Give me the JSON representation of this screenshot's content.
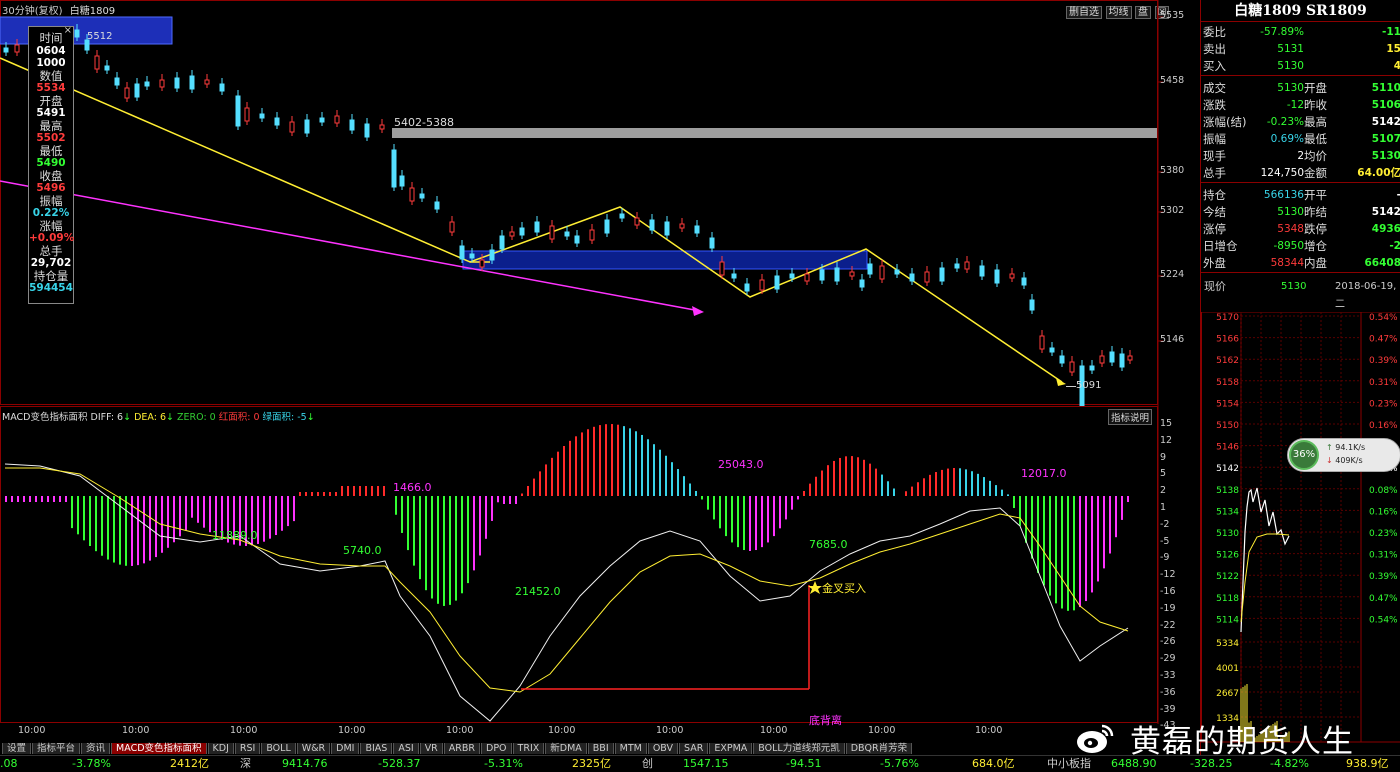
{
  "header": {
    "period": "30分钟(复权)",
    "symbol": "白糖1809",
    "buttons": [
      "删自选",
      "均线",
      "盘"
    ]
  },
  "tooltip": {
    "rows": [
      {
        "label": "时间",
        "value": "0604",
        "value2": "1000",
        "color": "#ffffff"
      },
      {
        "label": "数值",
        "value": "5534",
        "color": "#ff3b3b"
      },
      {
        "label": "开盘",
        "value": "5491",
        "color": "#ffffff"
      },
      {
        "label": "最高",
        "value": "5502",
        "color": "#ff3b3b"
      },
      {
        "label": "最低",
        "value": "5490",
        "color": "#33ff33"
      },
      {
        "label": "收盘",
        "value": "5496",
        "color": "#ff3b3b"
      },
      {
        "label": "振幅",
        "value": "0.22%",
        "color": "#38d4e8"
      },
      {
        "label": "涨幅",
        "value": "+0.09%",
        "color": "#ff3b3b"
      },
      {
        "label": "总手",
        "value": "29,702",
        "color": "#ffffff"
      },
      {
        "label": "持仓量",
        "value": "594454",
        "color": "#38d4e8"
      }
    ]
  },
  "main_chart": {
    "price_axis": [
      "5535",
      "5458",
      "5380",
      "5302",
      "5224",
      "5146"
    ],
    "annotations": {
      "top_box": "5512",
      "resistance": "5402-5388",
      "low": "5091"
    }
  },
  "macd": {
    "header": {
      "name": "MACD变色指标面积",
      "diff": "DIFF: 6",
      "dea": "DEA: 6",
      "zero": "ZERO: 0",
      "red_area": "红面积: 0",
      "green_area": "绿面积: -5"
    },
    "help_button": "指标说明",
    "axis": [
      "15",
      "12",
      "9",
      "5",
      "2",
      "1",
      "-2",
      "-5",
      "-9",
      "-12",
      "-16",
      "-19",
      "-22",
      "-26",
      "-29",
      "-33",
      "-36",
      "-39",
      "-43"
    ],
    "area_labels": {
      "a1": "11889.0",
      "a2": "5740.0",
      "a3": "1466.0",
      "a4": "21452.0",
      "a5": "25043.0",
      "a6": "7685.0",
      "a7": "12017.0"
    },
    "golden_cross": "金叉买入",
    "divergence": "底背离"
  },
  "time_axis": [
    "10:00",
    "10:00",
    "10:00",
    "10:00",
    "10:00",
    "10:00",
    "10:00",
    "10:00",
    "10:00",
    "10:00"
  ],
  "tabs": [
    "设置",
    "指标平台",
    "资讯",
    "MACD变色指标面积",
    "KDJ",
    "RSI",
    "BOLL",
    "W&R",
    "DMI",
    "BIAS",
    "ASI",
    "VR",
    "ARBR",
    "DPO",
    "TRIX",
    "新DMA",
    "BBI",
    "MTM",
    "OBV",
    "SAR",
    "EXPMA",
    "BOLL力道线郑元凯",
    "DBQR肖芳荣"
  ],
  "active_tab": "MACD变色指标面积",
  "right_panel": {
    "title": "白糖1809 SR1809",
    "rows": [
      {
        "l": "委比",
        "v": "-57.89%",
        "vc": "#33ff33",
        "r": "",
        "rv": "-11",
        "rvc": "#33ff33"
      },
      {
        "l": "卖出",
        "v": "5131",
        "vc": "#33ff33",
        "r": "",
        "rv": "15",
        "rvc": "#ffee33"
      },
      {
        "l": "买入",
        "v": "5130",
        "vc": "#33ff33",
        "r": "",
        "rv": "4",
        "rvc": "#ffee33"
      },
      {
        "l": "成交",
        "v": "5130",
        "vc": "#33ff33",
        "r": "开盘",
        "rv": "5110",
        "rvc": "#33ff33"
      },
      {
        "l": "涨跌",
        "v": "-12",
        "vc": "#33ff33",
        "r": "昨收",
        "rv": "5106",
        "rvc": "#33ff33"
      },
      {
        "l": "涨幅(结)",
        "v": "-0.23%",
        "vc": "#33ff33",
        "r": "最高",
        "rv": "5142",
        "rvc": "#ffffff"
      },
      {
        "l": "振幅",
        "v": "0.69%",
        "vc": "#38d4e8",
        "r": "最低",
        "rv": "5107",
        "rvc": "#33ff33"
      },
      {
        "l": "现手",
        "v": "2",
        "vc": "#ffffff",
        "r": "均价",
        "rv": "5130",
        "rvc": "#33ff33"
      },
      {
        "l": "总手",
        "v": "124,750",
        "vc": "#ffffff",
        "r": "金额",
        "rv": "64.00亿",
        "rvc": "#ffee33"
      },
      {
        "l": "持仓",
        "v": "566136",
        "vc": "#38d4e8",
        "r": "开平",
        "rv": "-",
        "rvc": "#ffffff"
      },
      {
        "l": "今结",
        "v": "5130",
        "vc": "#33ff33",
        "r": "昨结",
        "rv": "5142",
        "rvc": "#ffffff"
      },
      {
        "l": "涨停",
        "v": "5348",
        "vc": "#ff3b3b",
        "r": "跌停",
        "rv": "4936",
        "rvc": "#33ff33"
      },
      {
        "l": "日增仓",
        "v": "-8950",
        "vc": "#33ff33",
        "r": "增仓",
        "rv": "-2",
        "rvc": "#33ff33"
      },
      {
        "l": "外盘",
        "v": "58344",
        "vc": "#ff3b3b",
        "r": "内盘",
        "rv": "66408",
        "rvc": "#33ff33"
      }
    ],
    "now_label": "现价",
    "now_value": "5130",
    "date": "2018-06-19,二",
    "mini_prices": [
      "5170",
      "5166",
      "5162",
      "5158",
      "5154",
      "5150",
      "5146",
      "5142",
      "5138",
      "5134",
      "5130",
      "5126",
      "5122",
      "5118",
      "5114",
      "5334",
      "4001",
      "2667",
      "1334"
    ],
    "mini_pct": [
      "0.54%",
      "0.47%",
      "0.39%",
      "0.31%",
      "0.23%",
      "0.16%",
      "0.08%",
      "0.00%",
      "0.08%",
      "0.16%",
      "0.23%",
      "0.31%",
      "0.39%",
      "0.47%",
      "0.54%"
    ],
    "gauge": {
      "pct": "36%",
      "up": "94.1K/s",
      "down": "409K/s"
    }
  },
  "status_bar": {
    "items": [
      {
        "t": ".08",
        "c": "#33ff33"
      },
      {
        "t": "-3.78%",
        "c": "#33ff33"
      },
      {
        "t": "2412亿",
        "c": "#ffee33"
      },
      {
        "t": "深",
        "c": "#ccc"
      },
      {
        "t": "9414.76",
        "c": "#33ff33"
      },
      {
        "t": "-528.37",
        "c": "#33ff33"
      },
      {
        "t": "-5.31%",
        "c": "#33ff33"
      },
      {
        "t": "2325亿",
        "c": "#ffee33"
      },
      {
        "t": "创",
        "c": "#ccc"
      },
      {
        "t": "1547.15",
        "c": "#33ff33"
      },
      {
        "t": "-94.51",
        "c": "#33ff33"
      },
      {
        "t": "-5.76%",
        "c": "#33ff33"
      },
      {
        "t": "684.0亿",
        "c": "#ffee33"
      },
      {
        "t": "中小板指",
        "c": "#ccc"
      },
      {
        "t": "6488.90",
        "c": "#33ff33"
      },
      {
        "t": "-328.25",
        "c": "#33ff33"
      },
      {
        "t": "-4.82%",
        "c": "#33ff33"
      },
      {
        "t": "938.9亿",
        "c": "#ffee33"
      }
    ]
  },
  "watermark": "黄磊的期货人生"
}
